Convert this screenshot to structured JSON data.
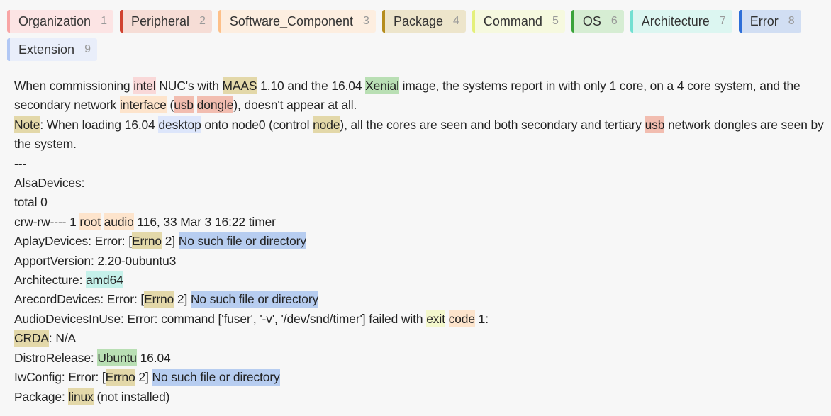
{
  "labels": [
    {
      "name": "Organization",
      "key": "1",
      "color": "#f8a5a5",
      "bg": "#fce4e4"
    },
    {
      "name": "Peripheral",
      "key": "2",
      "color": "#d0422f",
      "bg": "#f6ddd6"
    },
    {
      "name": "Software_Component",
      "key": "3",
      "color": "#fdc089",
      "bg": "#fdeee0"
    },
    {
      "name": "Package",
      "key": "4",
      "color": "#b58d1e",
      "bg": "#ede5cb"
    },
    {
      "name": "Command",
      "key": "5",
      "color": "#e4f07a",
      "bg": "#f6f9df"
    },
    {
      "name": "OS",
      "key": "6",
      "color": "#3aa33a",
      "bg": "#d6edd3"
    },
    {
      "name": "Architecture",
      "key": "7",
      "color": "#72e0d2",
      "bg": "#dcf6f1"
    },
    {
      "name": "Error",
      "key": "8",
      "color": "#2d6ed8",
      "bg": "#d1def3"
    },
    {
      "name": "Extension",
      "key": "9",
      "color": "#b2c8f4",
      "bg": "#e9eefa"
    }
  ],
  "entity_colors": {
    "Organization": "#f9d8d8",
    "Peripheral": "#f2bdb0",
    "Software_Component": "#fde4cc",
    "Package": "#e3d8a9",
    "Command": "#f4f8cd",
    "OS": "#b9dfb4",
    "Architecture": "#c6f1ea",
    "Error": "#b7cdf0",
    "Extension": "#dde6fb"
  },
  "lines": [
    [
      {
        "t": "When commissioning "
      },
      {
        "t": "intel",
        "e": "Organization"
      },
      {
        "t": " NUC's with "
      },
      {
        "t": "MAAS",
        "e": "Package"
      },
      {
        "t": " 1.10 and the 16.04 "
      },
      {
        "t": "Xenial",
        "e": "OS"
      },
      {
        "t": " image, the systems report in with only 1 core, on a 4 core system, and the secondary network "
      },
      {
        "t": "interface",
        "e": "Software_Component"
      },
      {
        "t": " ("
      },
      {
        "t": "usb",
        "e": "Peripheral"
      },
      {
        "t": " "
      },
      {
        "t": "dongle",
        "e": "Peripheral"
      },
      {
        "t": "), doesn't appear at all."
      }
    ],
    [
      {
        "t": "Note",
        "e": "Package"
      },
      {
        "t": ": When loading 16.04 "
      },
      {
        "t": "desktop",
        "e": "Extension"
      },
      {
        "t": " onto node0 (control "
      },
      {
        "t": "node",
        "e": "Package"
      },
      {
        "t": "), all the cores are seen and both secondary and tertiary "
      },
      {
        "t": "usb",
        "e": "Peripheral"
      },
      {
        "t": " network dongles are seen by the system."
      }
    ],
    [
      {
        "t": "---"
      }
    ],
    [
      {
        "t": "AlsaDevices:"
      }
    ],
    [
      {
        "t": "total 0"
      }
    ],
    [
      {
        "t": "crw-rw---- 1 "
      },
      {
        "t": "root",
        "e": "Software_Component"
      },
      {
        "t": " "
      },
      {
        "t": "audio",
        "e": "Software_Component"
      },
      {
        "t": " 116, 33 Mar 3 16:22 timer"
      }
    ],
    [
      {
        "t": "AplayDevices: Error: ["
      },
      {
        "t": "Errno",
        "e": "Package"
      },
      {
        "t": " 2] "
      },
      {
        "t": "No such file or directory",
        "e": "Error"
      }
    ],
    [
      {
        "t": "ApportVersion: 2.20-0ubuntu3"
      }
    ],
    [
      {
        "t": "Architecture: "
      },
      {
        "t": "amd64",
        "e": "Architecture"
      }
    ],
    [
      {
        "t": "ArecordDevices: Error: ["
      },
      {
        "t": "Errno",
        "e": "Package"
      },
      {
        "t": " 2] "
      },
      {
        "t": "No such file or directory",
        "e": "Error"
      }
    ],
    [
      {
        "t": "AudioDevicesInUse: Error: command ['fuser', '-v', '/dev/snd/timer'] failed with "
      },
      {
        "t": "exit",
        "e": "Command"
      },
      {
        "t": " "
      },
      {
        "t": "code",
        "e": "Software_Component"
      },
      {
        "t": " 1:"
      }
    ],
    [
      {
        "t": "CRDA",
        "e": "Package"
      },
      {
        "t": ": N/A"
      }
    ],
    [
      {
        "t": "DistroRelease: "
      },
      {
        "t": "Ubuntu",
        "e": "OS"
      },
      {
        "t": " 16.04"
      }
    ],
    [
      {
        "t": "IwConfig: Error: ["
      },
      {
        "t": "Errno",
        "e": "Package"
      },
      {
        "t": " 2] "
      },
      {
        "t": "No such file or directory",
        "e": "Error"
      }
    ],
    [
      {
        "t": "Package: "
      },
      {
        "t": "linux",
        "e": "Package"
      },
      {
        "t": " (not installed)"
      }
    ]
  ]
}
